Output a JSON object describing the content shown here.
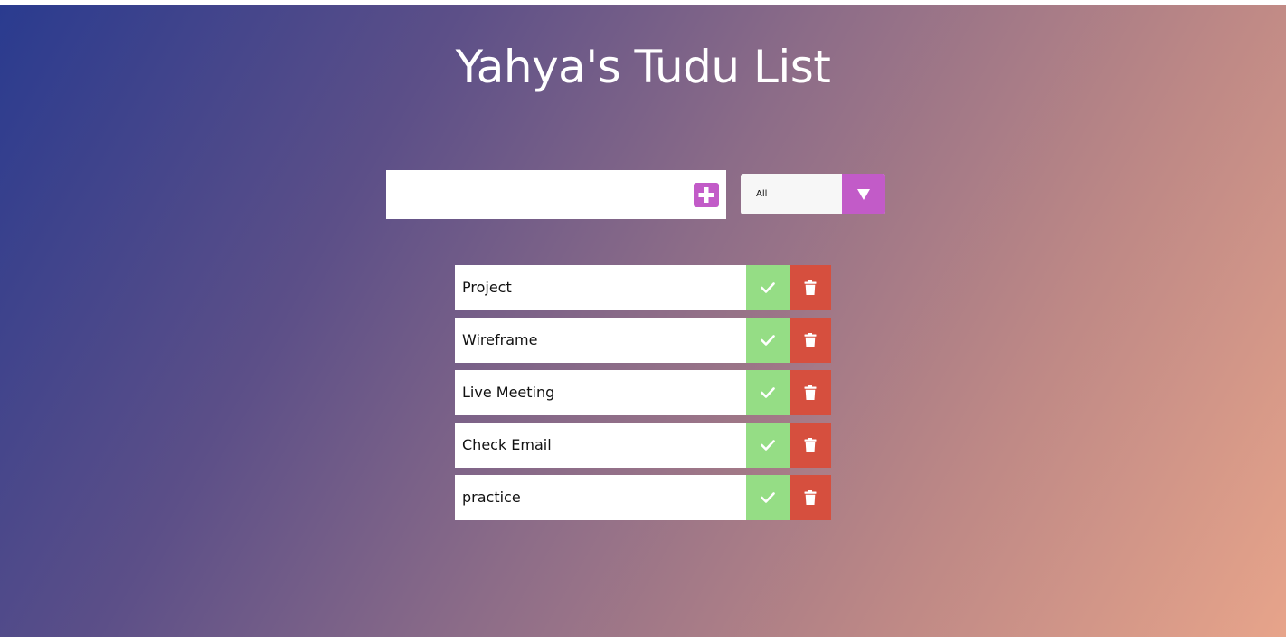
{
  "header": {
    "title": "Yahya's Tudu List"
  },
  "form": {
    "input_value": "",
    "add_icon": "plus-icon",
    "filter_selected": "All",
    "filter_icon": "caret-down-icon"
  },
  "todos": [
    {
      "text": "Project"
    },
    {
      "text": "Wireframe"
    },
    {
      "text": "Live Meeting"
    },
    {
      "text": "Check Email"
    },
    {
      "text": "practice"
    }
  ],
  "item_icons": {
    "complete": "check-icon",
    "delete": "trash-icon"
  },
  "colors": {
    "accent_purple": "#c25bc8",
    "complete_green": "#95dd85",
    "delete_red": "#d64f3e",
    "gradient_start": "#2a3b8f",
    "gradient_end": "#e7a48a"
  }
}
